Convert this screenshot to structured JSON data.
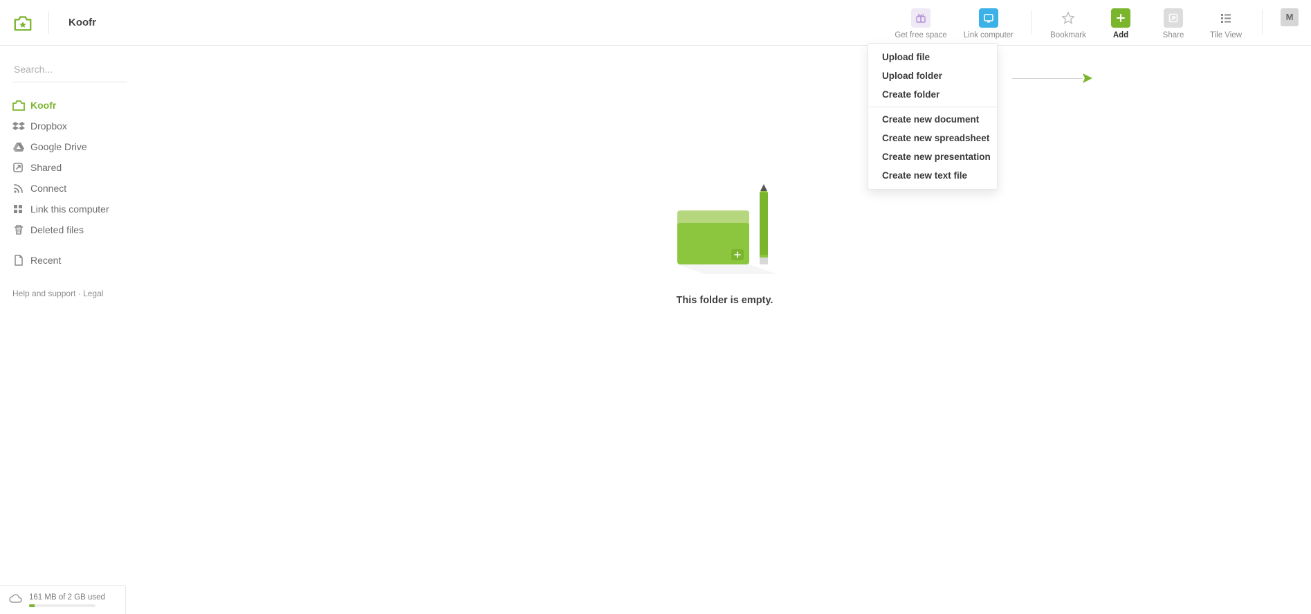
{
  "header": {
    "breadcrumb": "Koofr",
    "actions": {
      "free_space": "Get free space",
      "link_computer": "Link computer",
      "bookmark": "Bookmark",
      "add": "Add",
      "share": "Share",
      "tile_view": "Tile View"
    },
    "avatar_initial": "M"
  },
  "search": {
    "placeholder": "Search..."
  },
  "sidebar": {
    "items": [
      {
        "label": "Koofr",
        "icon": "koofr"
      },
      {
        "label": "Dropbox",
        "icon": "dropbox"
      },
      {
        "label": "Google Drive",
        "icon": "gdrive"
      },
      {
        "label": "Shared",
        "icon": "shared"
      },
      {
        "label": "Connect",
        "icon": "connect"
      },
      {
        "label": "Link this computer",
        "icon": "grid"
      },
      {
        "label": "Deleted files",
        "icon": "trash"
      }
    ],
    "recent_label": "Recent",
    "footer": {
      "help": "Help and support",
      "sep": " · ",
      "legal": "Legal"
    }
  },
  "storage": {
    "text": "161 MB of 2 GB used",
    "percent": 8
  },
  "empty": {
    "message": "This folder is empty."
  },
  "dropdown": {
    "group1": [
      "Upload file",
      "Upload folder",
      "Create folder"
    ],
    "group2": [
      "Create new document",
      "Create new spreadsheet",
      "Create new presentation",
      "Create new text file"
    ]
  }
}
